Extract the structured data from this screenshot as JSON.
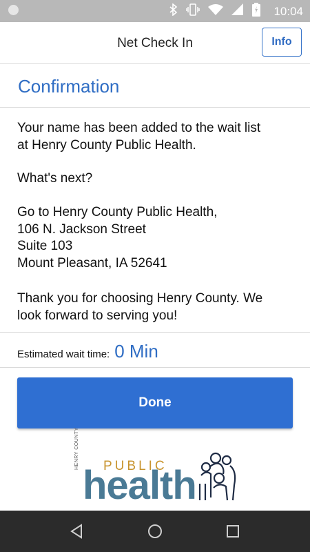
{
  "status_bar": {
    "time": "10:04",
    "icons": [
      "circle-icon",
      "bluetooth-icon",
      "vibrate-icon",
      "wifi-icon",
      "signal-icon",
      "battery-icon"
    ]
  },
  "header": {
    "title": "Net Check In",
    "info_label": "Info"
  },
  "confirmation": {
    "heading": "Confirmation",
    "paragraph1": [
      "Your name has been added to the wait list",
      "at Henry County Public Health."
    ],
    "whats_next": "What's next?",
    "address": [
      "Go to Henry County Public Health,",
      "106 N. Jackson Street",
      "Suite 103",
      "Mount Pleasant, IA 52641"
    ],
    "thanks": [
      "Thank you for choosing Henry County. We",
      "look forward to serving you!"
    ]
  },
  "wait": {
    "label": "Estimated wait time:",
    "value": "0 Min"
  },
  "done_label": "Done",
  "logo": {
    "small_text": "HENRY COUNTY",
    "public": "PUBLIC",
    "health": "health"
  },
  "colors": {
    "accent": "#2f6dc4",
    "button": "#2f6fd2",
    "status_bar": "#b8b8b8",
    "nav_bar": "#2b2b2b"
  },
  "nav": [
    "back-icon",
    "home-icon",
    "recents-icon"
  ]
}
